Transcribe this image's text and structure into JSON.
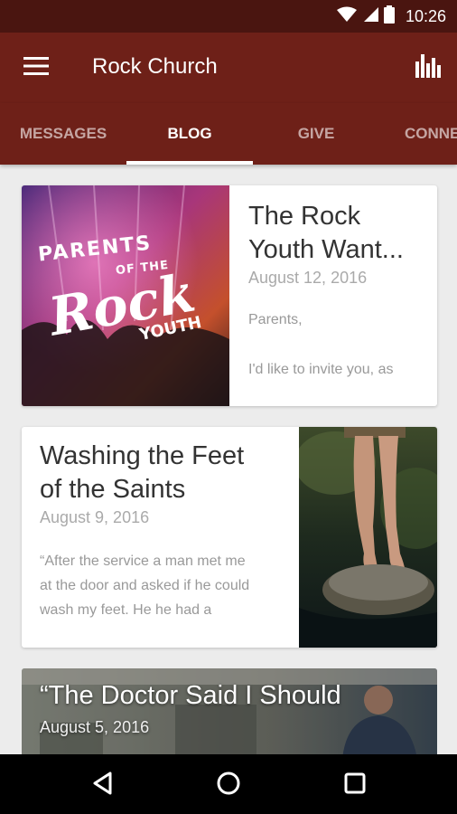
{
  "status_bar": {
    "time": "10:26"
  },
  "app_bar": {
    "title": "Rock Church"
  },
  "tabs": [
    {
      "label": "MESSAGES"
    },
    {
      "label": "BLOG"
    },
    {
      "label": "GIVE"
    },
    {
      "label": "CONNE"
    }
  ],
  "active_tab": "BLOG",
  "posts": [
    {
      "title": "The Rock Youth Want...",
      "title_line1": "The Rock",
      "title_line2": "Youth Want...",
      "date": "August 12, 2016",
      "excerpt_line1": "Parents,",
      "excerpt_line2": "I'd like to invite you, as",
      "image_text": {
        "line1": "PARENTS",
        "line2": "OF THE",
        "line3": "Rock",
        "line4": "YOUTH"
      }
    },
    {
      "title_line1": "Washing the Feet",
      "title_line2": "of the Saints",
      "date": "August 9, 2016",
      "excerpt_line1": "“After the service a man met me",
      "excerpt_line2": "at the door and asked if he could",
      "excerpt_line3": "wash my feet. He he had a"
    },
    {
      "title": "“The Doctor Said I Should",
      "date": "August 5, 2016"
    }
  ],
  "colors": {
    "status_bar": "#4a1510",
    "primary": "#6e2018",
    "background": "#ececec"
  },
  "icons": {
    "menu": "hamburger-menu-icon",
    "stats": "bar-chart-icon",
    "wifi": "wifi-icon",
    "signal": "signal-icon",
    "battery": "battery-icon",
    "back": "back-triangle-icon",
    "home": "home-circle-icon",
    "recents": "recents-square-icon"
  }
}
